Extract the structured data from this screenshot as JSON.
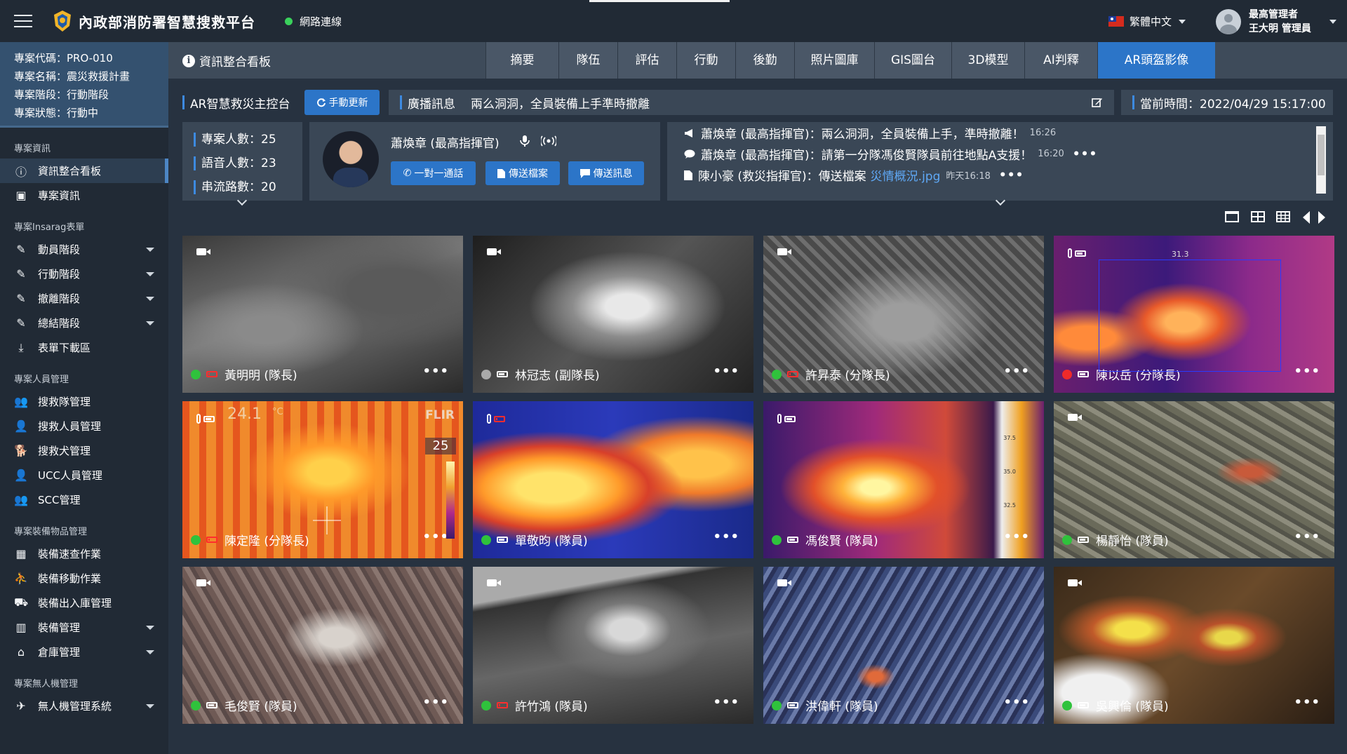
{
  "header": {
    "title": "內政部消防署智慧搜救平台",
    "network_status": "網路連線",
    "language": "繁體中文",
    "user_role": "最高管理者",
    "user_name": "王大明 管理員"
  },
  "project": {
    "code": "專案代碼：PRO-010",
    "name": "專案名稱：震災救援計畫",
    "stage": "專案階段：行動階段",
    "status": "專案狀態：行動中"
  },
  "sidebar": {
    "sections": [
      {
        "title": "專案資訊",
        "items": [
          {
            "label": "資訊整合看板",
            "icon": "info-circle-icon",
            "active": true,
            "expand": false
          },
          {
            "label": "專案資訊",
            "icon": "clipboard-icon",
            "active": false,
            "expand": false
          }
        ]
      },
      {
        "title": "專案Insarag表單",
        "items": [
          {
            "label": "動員階段",
            "icon": "edit-icon",
            "active": false,
            "expand": true
          },
          {
            "label": "行動階段",
            "icon": "edit-icon",
            "active": false,
            "expand": true
          },
          {
            "label": "撤離階段",
            "icon": "edit-icon",
            "active": false,
            "expand": true
          },
          {
            "label": "總結階段",
            "icon": "edit-icon",
            "active": false,
            "expand": true
          },
          {
            "label": "表單下載區",
            "icon": "download-icon",
            "active": false,
            "expand": false
          }
        ]
      },
      {
        "title": "專案人員管理",
        "items": [
          {
            "label": "搜救隊管理",
            "icon": "users-icon",
            "active": false,
            "expand": false
          },
          {
            "label": "搜救人員管理",
            "icon": "user-icon",
            "active": false,
            "expand": false
          },
          {
            "label": "搜救犬管理",
            "icon": "dog-icon",
            "active": false,
            "expand": false
          },
          {
            "label": "UCC人員管理",
            "icon": "user-tie-icon",
            "active": false,
            "expand": false
          },
          {
            "label": "SCC管理",
            "icon": "users-icon",
            "active": false,
            "expand": false
          }
        ]
      },
      {
        "title": "專案裝備物品管理",
        "items": [
          {
            "label": "裝備速查作業",
            "icon": "grid-icon",
            "active": false,
            "expand": false
          },
          {
            "label": "裝備移動作業",
            "icon": "people-carry-icon",
            "active": false,
            "expand": false
          },
          {
            "label": "裝備出入庫管理",
            "icon": "dolly-icon",
            "active": false,
            "expand": false
          },
          {
            "label": "裝備管理",
            "icon": "chart-icon",
            "active": false,
            "expand": true
          },
          {
            "label": "倉庫管理",
            "icon": "warehouse-icon",
            "active": false,
            "expand": true
          }
        ]
      },
      {
        "title": "專案無人機管理",
        "items": [
          {
            "label": "無人機管理系統",
            "icon": "plane-icon",
            "active": false,
            "expand": true
          }
        ]
      }
    ]
  },
  "main": {
    "title": "資訊整合看板",
    "tabs": [
      "摘要",
      "隊伍",
      "評估",
      "行動",
      "後勤",
      "照片圖庫",
      "GIS圖台",
      "3D模型",
      "AI判釋",
      "AR頭盔影像"
    ],
    "active_tab": "AR頭盔影像"
  },
  "console": {
    "title": "AR智慧救災主控台",
    "refresh_button": "手動更新",
    "broadcast_label": "廣播訊息",
    "broadcast_text": "兩么洞洞，全員裝備上手準時撤離",
    "time_label": "當前時間：2022/04/29 15:17:00"
  },
  "stats": {
    "project_count": "專案人數：25",
    "voice_count": "語音人數：23",
    "stream_count": "串流路數：20"
  },
  "commander": {
    "name": "蕭煥章 (最高指揮官)",
    "call_button": "一對一通話",
    "file_button": "傳送檔案",
    "message_button": "傳送訊息"
  },
  "messages": [
    {
      "icon": "megaphone-icon",
      "text": "蕭煥章 (最高指揮官)：兩么洞洞，全員裝備上手，準時撤離！",
      "link": "",
      "time": "16:26",
      "more": ""
    },
    {
      "icon": "comment-icon",
      "text": "蕭煥章 (最高指揮官)：請第一分隊馮俊賢隊員前往地點A支援！",
      "link": "",
      "time": "16:20",
      "more": "•••"
    },
    {
      "icon": "file-icon",
      "text": "陳小豪 (救災指揮官)：傳送檔案",
      "link": "災情概況.jpg",
      "time": "昨天16:18",
      "more": "•••"
    }
  ],
  "tiles": [
    {
      "name": "黃明明 (隊長)",
      "status": "green",
      "battery": "red",
      "cam": "video",
      "bg": "gray1"
    },
    {
      "name": "林冠志 (副隊長)",
      "status": "grey",
      "battery": "white",
      "cam": "video",
      "bg": "gray2"
    },
    {
      "name": "許昇泰 (分隊長)",
      "status": "green",
      "battery": "red",
      "cam": "video",
      "bg": "gray3"
    },
    {
      "name": "陳以岳 (分隊長)",
      "status": "red",
      "battery": "white",
      "cam": "thermal",
      "bg": "thermal1"
    },
    {
      "name": "陳定隆 (分隊長)",
      "status": "green",
      "battery": "red",
      "cam": "thermal",
      "bg": "thermal2"
    },
    {
      "name": "單敬昀 (隊員)",
      "status": "green",
      "battery": "white",
      "cam": "thermal",
      "bg": "thermal3"
    },
    {
      "name": "馮俊賢 (隊員)",
      "status": "green",
      "battery": "white",
      "cam": "thermal",
      "bg": "thermal4"
    },
    {
      "name": "楊靜怡 (隊員)",
      "status": "green",
      "battery": "white",
      "cam": "video",
      "bg": "color1"
    },
    {
      "name": "毛俊賢 (隊員)",
      "status": "green",
      "battery": "white",
      "cam": "video",
      "bg": "color2"
    },
    {
      "name": "許竹鴻 (隊員)",
      "status": "green",
      "battery": "red",
      "cam": "video",
      "bg": "gray4"
    },
    {
      "name": "洪偉軒 (隊員)",
      "status": "green",
      "battery": "white",
      "cam": "video",
      "bg": "color3"
    },
    {
      "name": "吳興倫 (隊員)",
      "status": "green",
      "battery": "white",
      "cam": "video",
      "bg": "color4"
    }
  ],
  "overlays": {
    "thermal2_temp": "24.1",
    "thermal2_unit": "°C",
    "thermal2_brand": "FLIR",
    "thermal2_scale": "25",
    "thermal1_label": "31.3",
    "thermal4_ticks": [
      "37.5",
      "35.0",
      "32.5"
    ]
  }
}
